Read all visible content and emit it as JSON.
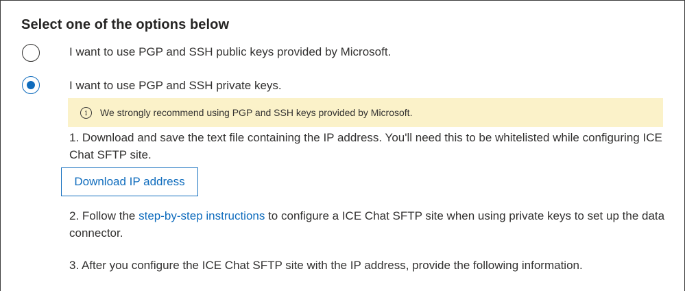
{
  "section": {
    "heading": "Select one of the options below"
  },
  "options": [
    {
      "label": "I want to use PGP and SSH public keys provided by Microsoft.",
      "checked": false
    },
    {
      "label": "I want to use PGP and SSH private keys.",
      "checked": true
    }
  ],
  "banner": {
    "icon": "info-icon",
    "text": "We strongly recommend using PGP and SSH keys provided by Microsoft."
  },
  "steps": {
    "step1": "1. Download and save the text file containing the IP address. You'll need this to be whitelisted while configuring ICE Chat SFTP site.",
    "download_button": "Download IP address",
    "step2_prefix": "2. Follow the ",
    "step2_link": "step-by-step instructions",
    "step2_suffix": " to configure a ICE Chat SFTP site when using private keys to set up the data connector.",
    "step3": "3. After you configure the ICE Chat SFTP site with the IP address, provide the following information."
  },
  "colors": {
    "accent": "#0f6cbd",
    "banner_bg": "#fbf2c9"
  }
}
